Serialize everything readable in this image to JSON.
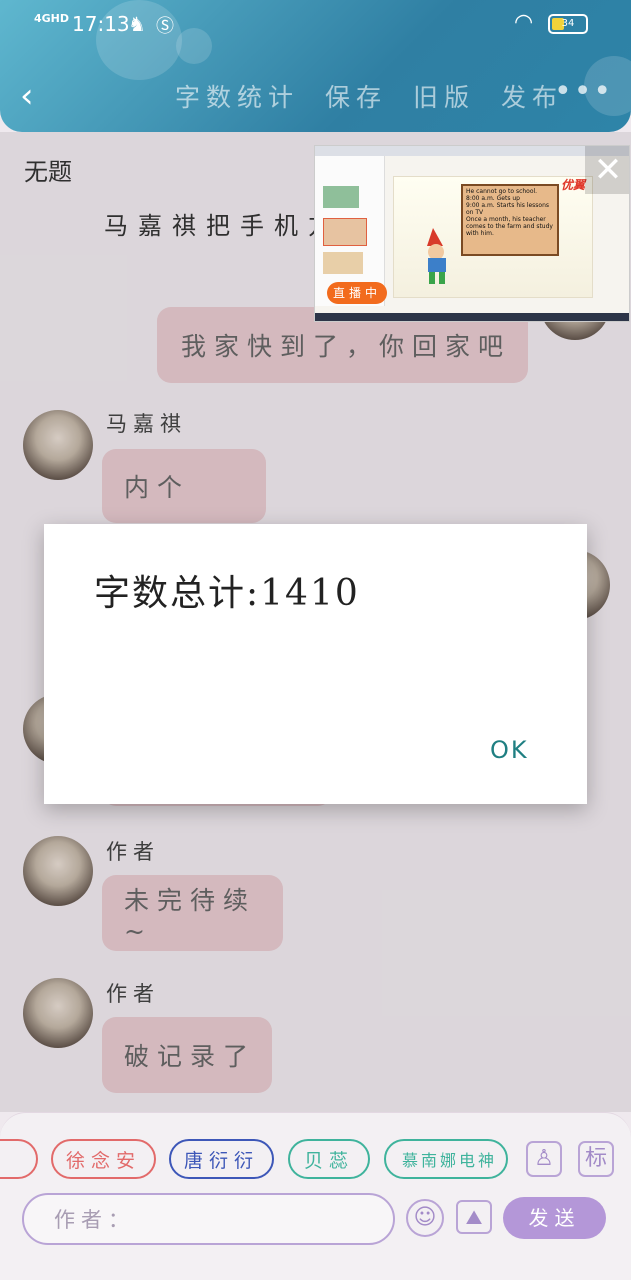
{
  "status_bar": {
    "network": "4GHD",
    "time": "17:13",
    "battery": "34"
  },
  "toolbar": {
    "items": [
      "字数统计",
      "保存",
      "旧版",
      "发布"
    ],
    "more": "•••"
  },
  "document": {
    "title": "无题",
    "intro": "马嘉祺把手机方"
  },
  "messages": [
    {
      "text": "我家快到了，你回家吧"
    },
    {
      "sender": "马嘉祺",
      "text": "内个"
    },
    {
      "sender": "作者",
      "text": "未完待续~"
    },
    {
      "sender": "作者",
      "text": "破记录了"
    }
  ],
  "video": {
    "live_label": "直播中",
    "logo": "优翼",
    "slide_lines": [
      "He cannot go to school.",
      "8:00 a.m.  Gets up",
      "9:00 a.m.  Starts his lessons on TV",
      "Once a month, his teacher comes to the farm and study with him."
    ]
  },
  "dialog": {
    "message": "字数总计:1410",
    "ok": "OK"
  },
  "bottom": {
    "chips": [
      {
        "label": "徐念安",
        "color": "#e26a6a"
      },
      {
        "label": "唐衍衍",
        "color": "#3d57b8"
      },
      {
        "label": "贝蕊",
        "color": "#3fb39c"
      },
      {
        "label": "慕南娜电神",
        "color": "#3fb39c"
      }
    ],
    "profile_icon": "person-icon",
    "tag_icon_text": "标",
    "input_placeholder": "作者：",
    "send": "发送"
  }
}
